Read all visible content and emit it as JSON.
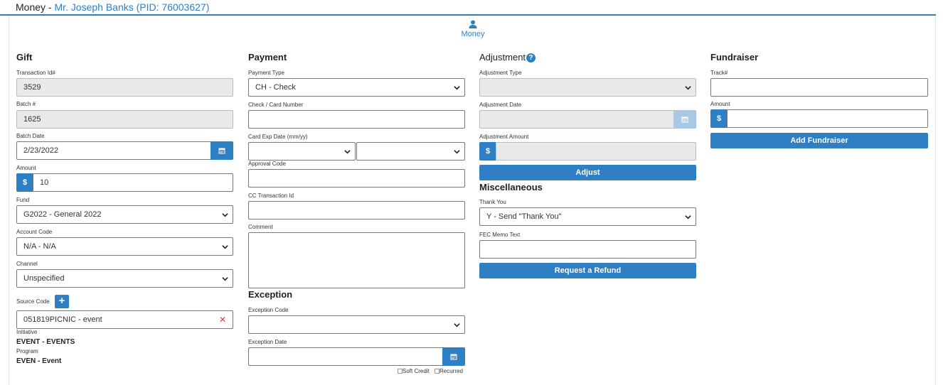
{
  "header": {
    "prefix": "Money - ",
    "name": "Mr. Joseph Banks (PID: 76003627)"
  },
  "tab": {
    "label": "Money",
    "icon": "user-icon"
  },
  "gift": {
    "title": "Gift",
    "transaction_id_label": "Transaction Id#",
    "transaction_id": "3529",
    "batch_label": "Batch #",
    "batch": "1625",
    "batch_date_label": "Batch Date",
    "batch_date": "2/23/2022",
    "amount_label": "Amount",
    "currency": "$",
    "amount": "10",
    "fund_label": "Fund",
    "fund": "G2022 - General 2022",
    "account_code_label": "Account Code",
    "account_code": "N/A - N/A",
    "channel_label": "Channel",
    "channel": "Unspecified",
    "source_code_label": "Source Code",
    "source_code": "051819PICNIC - event",
    "remove_glyph": "✕",
    "initiative_label": "Initiative",
    "initiative": "EVENT - EVENTS",
    "program_label": "Program",
    "program": "EVEN - Event"
  },
  "payment": {
    "title": "Payment",
    "payment_type_label": "Payment Type",
    "payment_type": "CH - Check",
    "check_number_label": "Check / Card Number",
    "check_number": "",
    "card_exp_label": "Card Exp Date (mm/yy)",
    "approval_code_label": "Approval Code",
    "cc_transaction_label": "CC Transaction Id",
    "comment_label": "Comment",
    "exception_title": "Exception",
    "exception_code_label": "Exception Code",
    "exception_date_label": "Exception Date",
    "soft_credit_label": "Soft Credit",
    "recurred_label": "Recurred"
  },
  "adjustment": {
    "title": "Adjustment",
    "help_glyph": "?",
    "type_label": "Adjustment Type",
    "date_label": "Adjustment Date",
    "amount_label": "Adjustment Amount",
    "currency": "$",
    "adjust_button": "Adjust"
  },
  "misc": {
    "title": "Miscellaneous",
    "thank_you_label": "Thank You",
    "thank_you": "Y - Send \"Thank You\"",
    "fec_memo_label": "FEC Memo Text",
    "refund_button": "Request a Refund"
  },
  "fundraiser": {
    "title": "Fundraiser",
    "track_label": "Track#",
    "amount_label": "Amount",
    "currency": "$",
    "add_button": "Add Fundraiser"
  },
  "colors": {
    "accent": "#2e7fc3",
    "disabled": "#e8e9eb",
    "danger": "#e03b3b"
  }
}
